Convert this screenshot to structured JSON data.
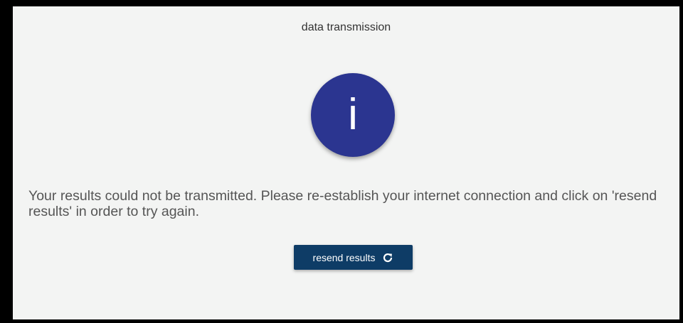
{
  "dialog": {
    "title": "data transmission",
    "icon": "info-icon",
    "icon_glyph": "i",
    "message": "Your results could not be transmitted. Please re-establish your internet connection and click on 'resend results' in order to try again.",
    "resend_button_label": "resend results",
    "resend_button_icon": "refresh-icon"
  },
  "colors": {
    "background": "#f3f4f3",
    "frame": "#000000",
    "info_circle": "#2b3590",
    "button": "#0e3c66",
    "button_text": "#ffffff",
    "message_text": "#555555"
  }
}
